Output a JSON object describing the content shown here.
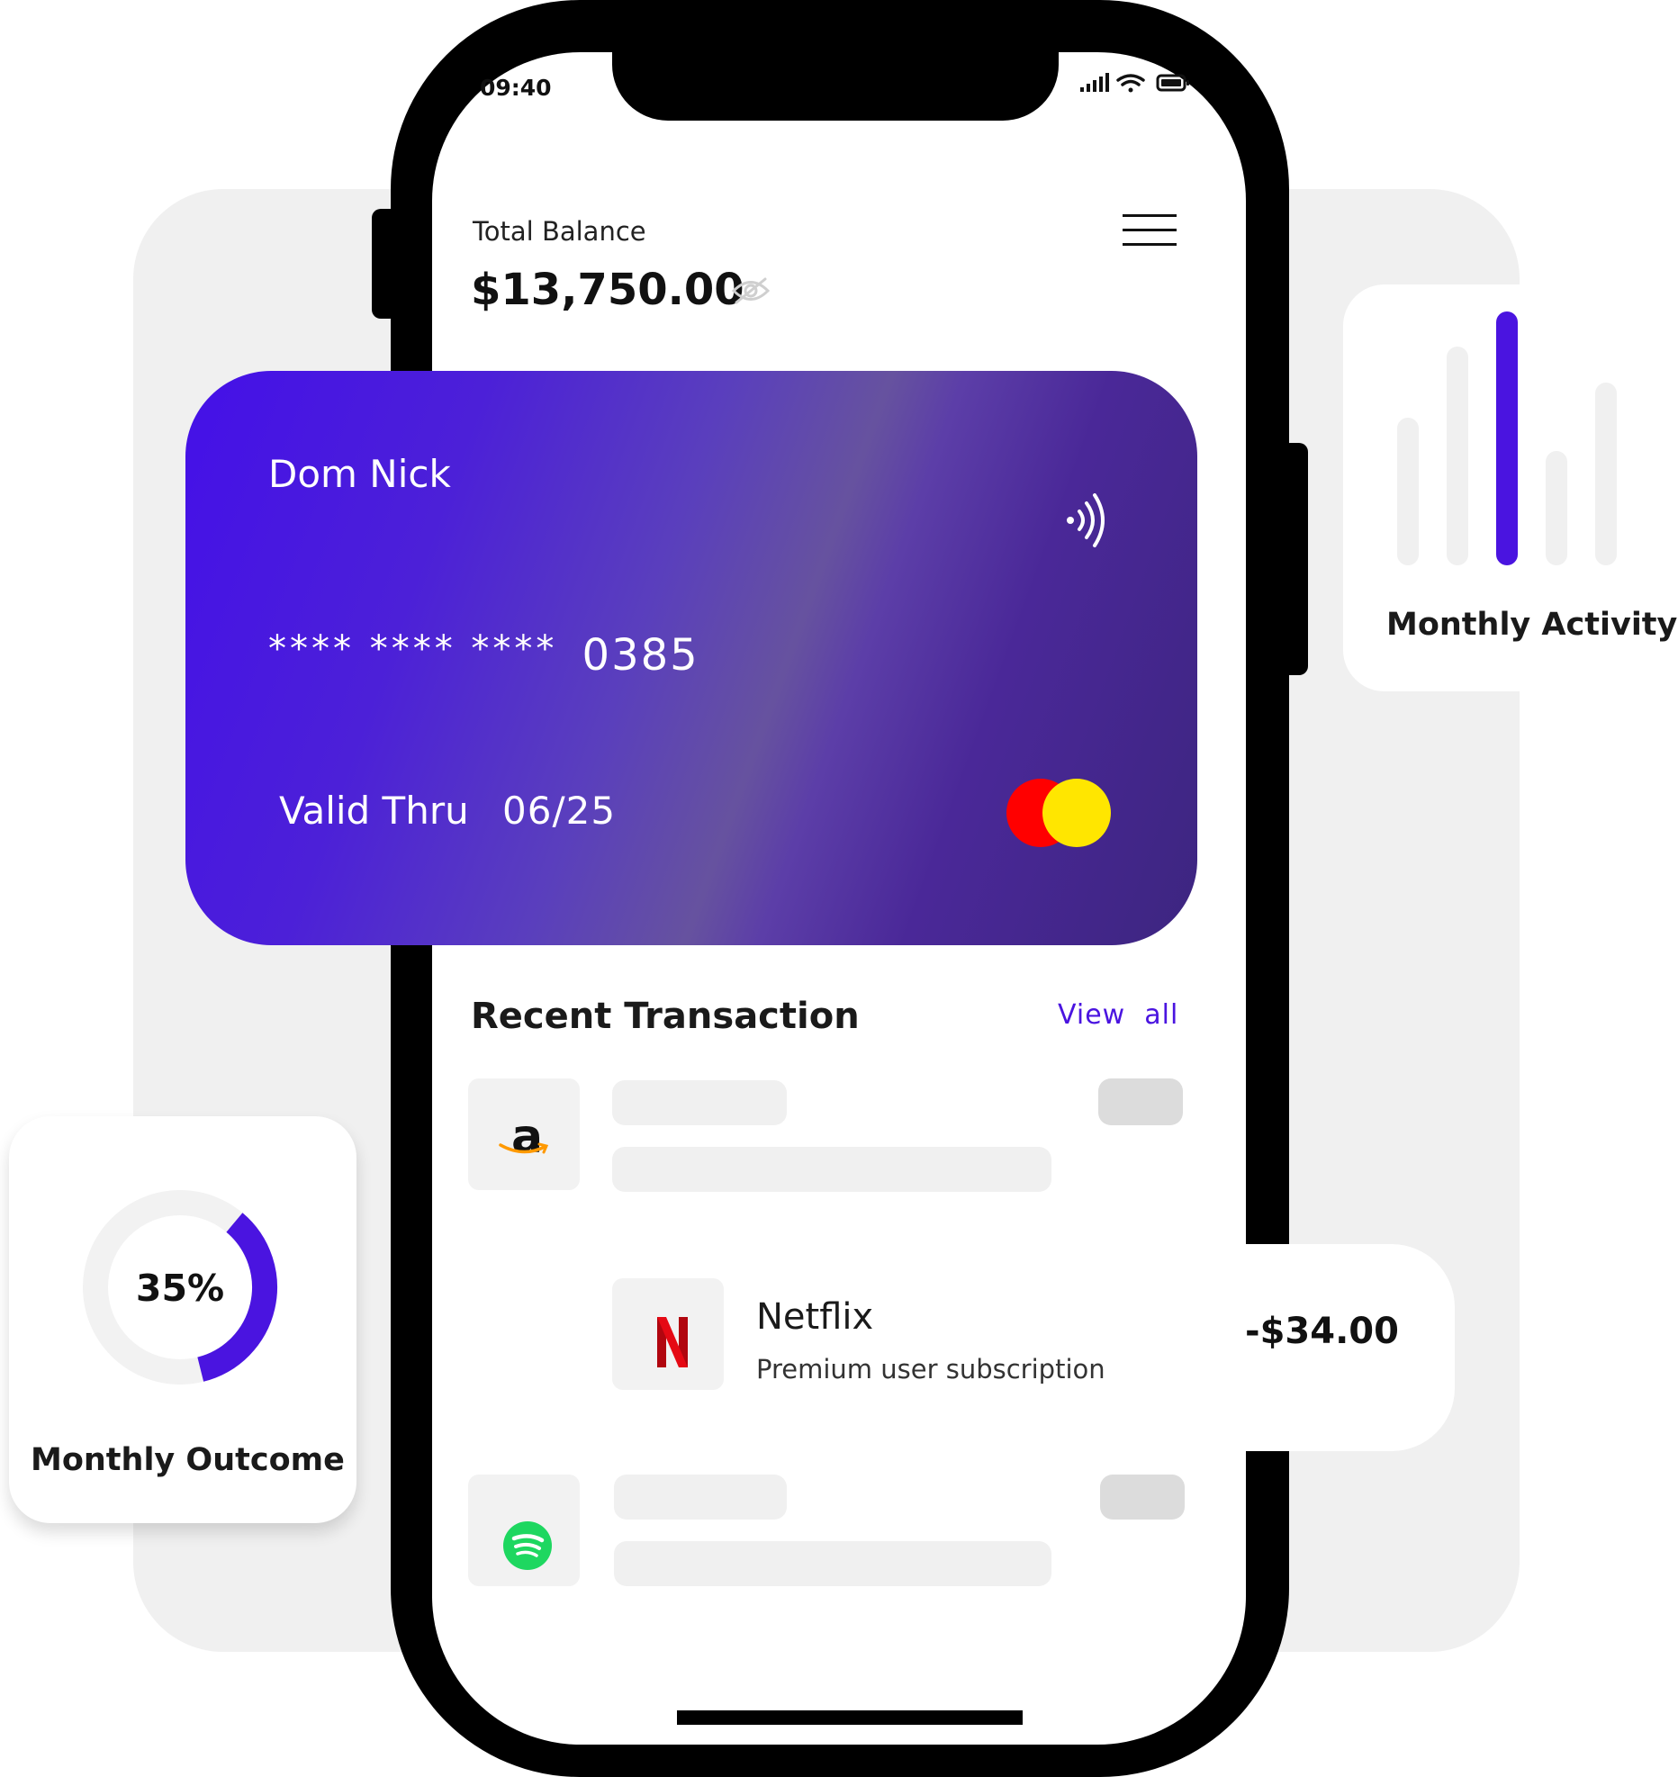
{
  "status_bar": {
    "time": "09:40"
  },
  "header": {
    "balance_label": "Total Balance",
    "balance_value": "$13,750.00"
  },
  "card": {
    "holder_name": "Dom Nick",
    "number_mask": "**** **** ****",
    "number_last4": "0385",
    "valid_label": "Valid Thru",
    "expiry": "06/25",
    "gradient_colors": [
      "#4410e8",
      "#5a3fbd",
      "#66529f",
      "#3d2580"
    ],
    "network_colors": [
      "#ff0000",
      "#ffe600"
    ]
  },
  "transactions": {
    "title": "Recent Transaction",
    "view_all": "View  all",
    "items": [
      {
        "logo": "amazon-logo"
      },
      {
        "logo": "netflix-logo",
        "name": "Netflix",
        "description": "Premium user subscription",
        "amount": "-$34.00"
      },
      {
        "logo": "spotify-logo"
      }
    ]
  },
  "monthly_activity": {
    "label": "Monthly Activity",
    "bar_levels": [
      0.58,
      0.86,
      1.0,
      0.45,
      0.72
    ],
    "active_index": 2,
    "accent": "#4a14e0"
  },
  "monthly_outcome": {
    "label": "Monthly Outcome",
    "percent_label": "35%",
    "fraction": 0.35,
    "accent": "#4a14e0"
  }
}
